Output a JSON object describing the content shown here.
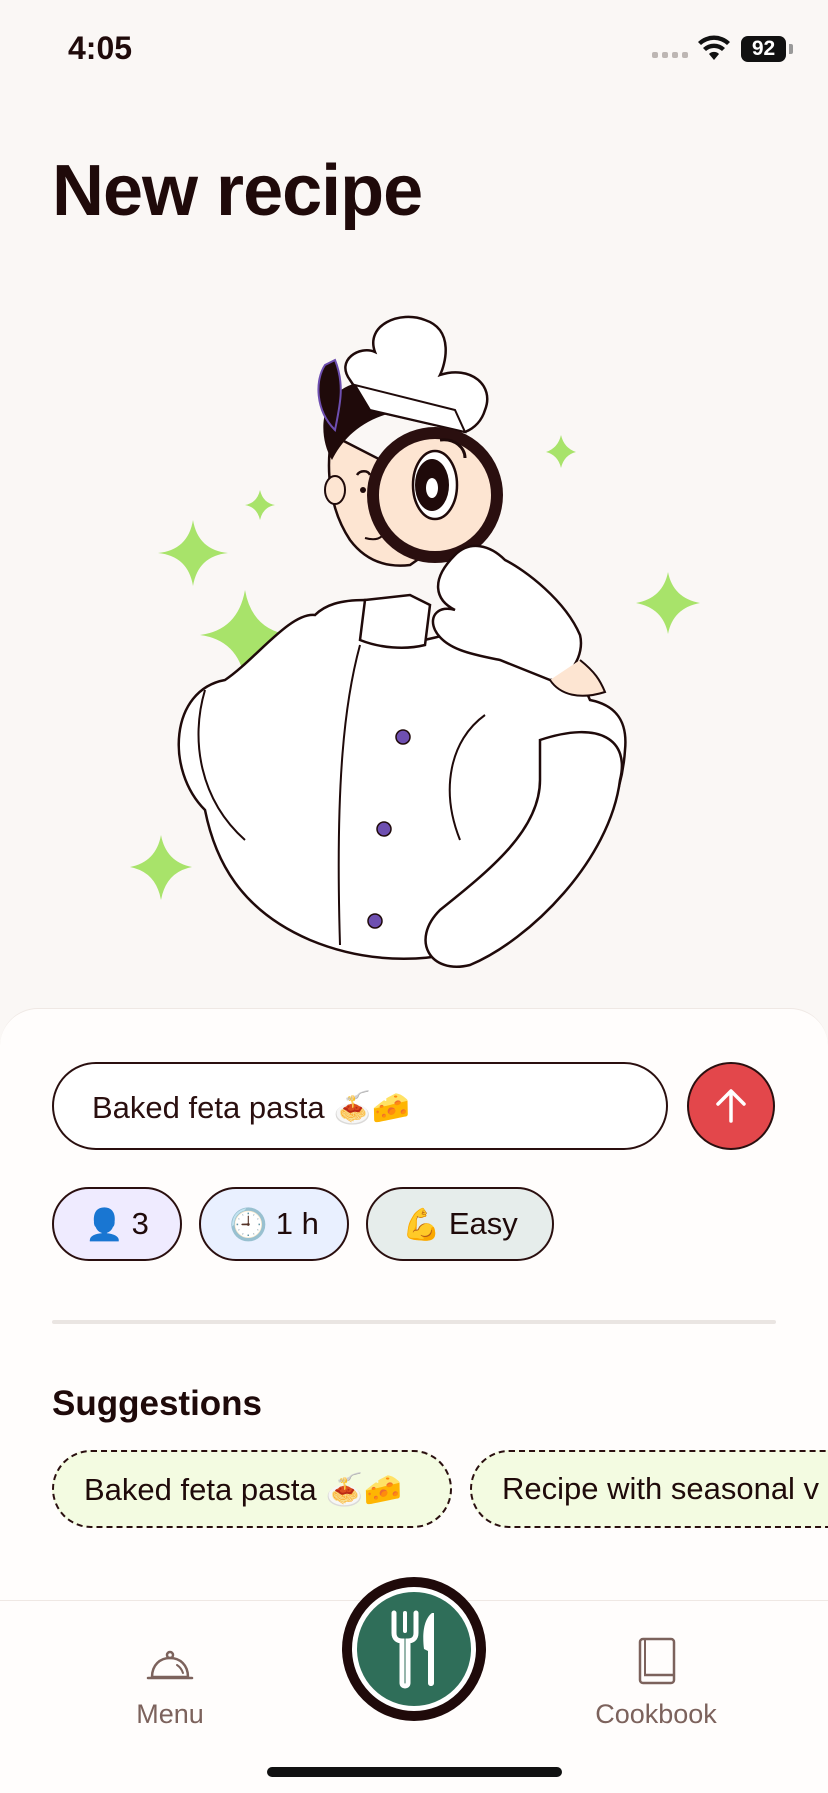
{
  "status_bar": {
    "time": "4:05",
    "battery": "92"
  },
  "page": {
    "title": "New recipe"
  },
  "recipe_input": {
    "value": "Baked feta pasta 🍝🧀"
  },
  "chips": [
    {
      "emoji": "👤",
      "label": "3"
    },
    {
      "emoji": "🕘",
      "label": "1 h"
    },
    {
      "emoji": "💪",
      "label": "Easy"
    }
  ],
  "suggestions": {
    "title": "Suggestions",
    "items": [
      {
        "label": "Baked feta pasta 🍝🧀"
      },
      {
        "label": "Recipe with seasonal v"
      }
    ]
  },
  "tabbar": {
    "items": [
      {
        "label": "Menu",
        "icon": "cloche-icon"
      },
      {
        "label": "",
        "icon": "fork-knife-icon"
      },
      {
        "label": "Cookbook",
        "icon": "book-icon"
      }
    ]
  },
  "colors": {
    "accent_green": "#2F6E59",
    "send_red": "#E3474B",
    "sparkle": "#A8E36A",
    "text": "#1F0A0A"
  }
}
